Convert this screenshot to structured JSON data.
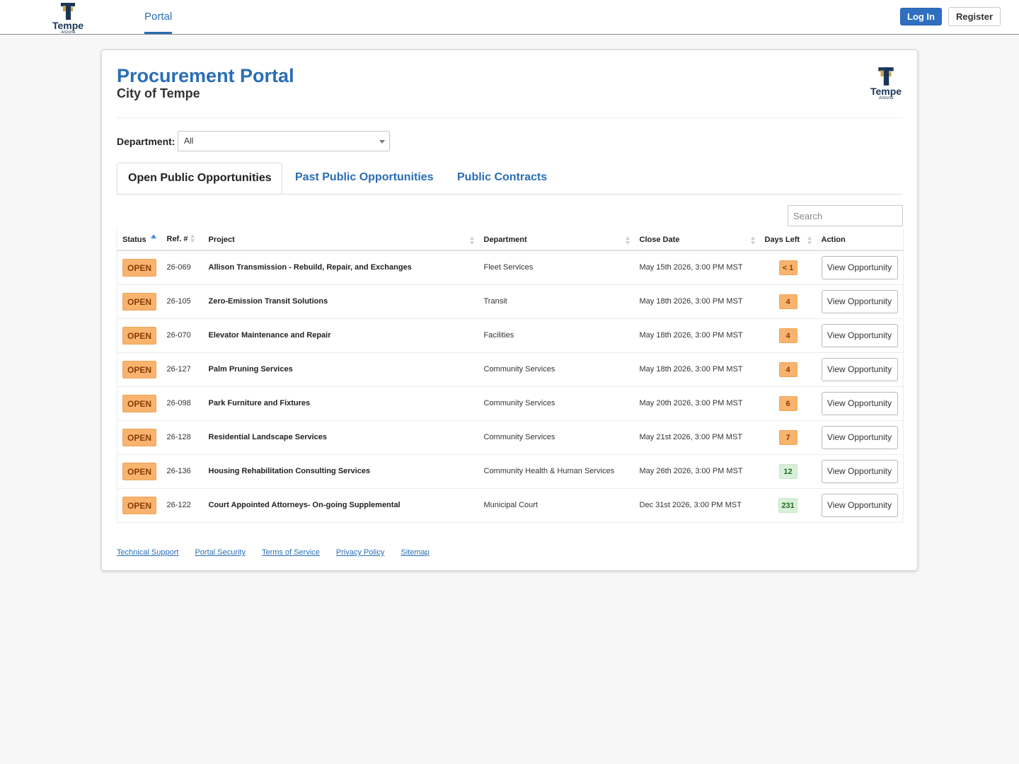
{
  "nav": {
    "logo": {
      "word": "Tempe",
      "sub": "Arizona"
    },
    "tab_portal": "Portal",
    "login_label": "Log In",
    "register_label": "Register"
  },
  "header": {
    "title": "Procurement Portal",
    "subtitle": "City of Tempe",
    "logo": {
      "word": "Tempe",
      "sub": "Arizona"
    }
  },
  "filter": {
    "department_label": "Department:",
    "department_value": "All"
  },
  "tabs": [
    {
      "label": "Open Public Opportunities",
      "active": true
    },
    {
      "label": "Past Public Opportunities",
      "active": false
    },
    {
      "label": "Public Contracts",
      "active": false
    }
  ],
  "search": {
    "placeholder": "Search"
  },
  "table": {
    "columns": [
      "Status",
      "Ref. #",
      "Project",
      "Department",
      "Close Date",
      "Days Left",
      "Action"
    ],
    "rows": [
      {
        "status": "OPEN",
        "ref": "26-069",
        "project": "Allison Transmission - Rebuild, Repair, and Exchanges",
        "department": "Fleet Services",
        "close_date": "May 15th 2026, 3:00 PM MST",
        "days_left": "< 1",
        "days_color": "orange",
        "action": "View Opportunity"
      },
      {
        "status": "OPEN",
        "ref": "26-105",
        "project": "Zero-Emission Transit Solutions",
        "department": "Transit",
        "close_date": "May 18th 2026, 3:00 PM MST",
        "days_left": "4",
        "days_color": "orange",
        "action": "View Opportunity"
      },
      {
        "status": "OPEN",
        "ref": "26-070",
        "project": "Elevator Maintenance and Repair",
        "department": "Facilities",
        "close_date": "May 18th 2026, 3:00 PM MST",
        "days_left": "4",
        "days_color": "orange",
        "action": "View Opportunity"
      },
      {
        "status": "OPEN",
        "ref": "26-127",
        "project": "Palm Pruning Services",
        "department": "Community Services",
        "close_date": "May 18th 2026, 3:00 PM MST",
        "days_left": "4",
        "days_color": "orange",
        "action": "View Opportunity"
      },
      {
        "status": "OPEN",
        "ref": "26-098",
        "project": "Park Furniture and Fixtures",
        "department": "Community Services",
        "close_date": "May 20th 2026, 3:00 PM MST",
        "days_left": "6",
        "days_color": "orange",
        "action": "View Opportunity"
      },
      {
        "status": "OPEN",
        "ref": "26-128",
        "project": "Residential Landscape Services",
        "department": "Community Services",
        "close_date": "May 21st 2026, 3:00 PM MST",
        "days_left": "7",
        "days_color": "orange",
        "action": "View Opportunity"
      },
      {
        "status": "OPEN",
        "ref": "26-136",
        "project": "Housing Rehabilitation Consulting Services",
        "department": "Community Health & Human Services",
        "close_date": "May 26th 2026, 3:00 PM MST",
        "days_left": "12",
        "days_color": "green",
        "action": "View Opportunity"
      },
      {
        "status": "OPEN",
        "ref": "26-122",
        "project": "Court Appointed Attorneys- On-going Supplemental",
        "department": "Municipal Court",
        "close_date": "Dec 31st 2026, 3:00 PM MST",
        "days_left": "231",
        "days_color": "green",
        "action": "View Opportunity"
      }
    ]
  },
  "footer": {
    "links": [
      "Technical Support",
      "Portal Security",
      "Terms of Service",
      "Privacy Policy",
      "Sitemap"
    ]
  },
  "colors": {
    "brand_blue": "#2a6db5",
    "logo_navy": "#1b3556",
    "logo_gold": "#c9a24a",
    "badge_orange": "#f8b46e",
    "badge_green": "#d8f0d8"
  }
}
